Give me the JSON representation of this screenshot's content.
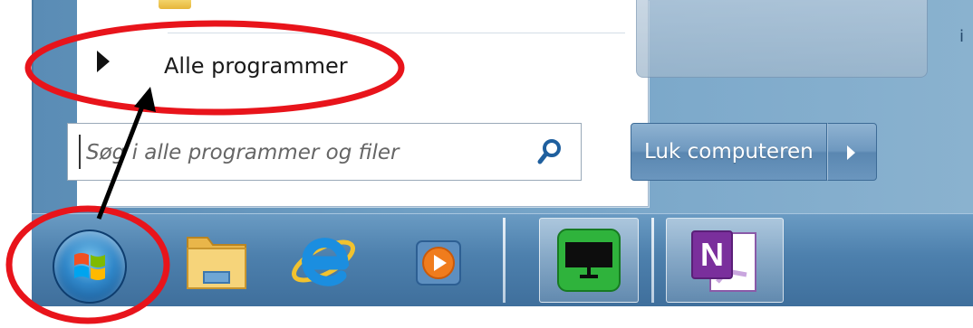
{
  "start_menu": {
    "all_programs_label": "Alle programmer",
    "search": {
      "placeholder": "Søg i alle programmer og filer",
      "value": ""
    },
    "shutdown_label": "Luk computeren",
    "right_edge_text": "i"
  },
  "taskbar": {
    "items": [
      {
        "name": "start-orb",
        "icon": "windows-logo-icon"
      },
      {
        "name": "file-explorer",
        "icon": "folder-icon"
      },
      {
        "name": "internet-explorer",
        "icon": "internet-explorer-icon"
      },
      {
        "name": "media-player",
        "icon": "media-player-icon"
      },
      {
        "name": "remote-desktop",
        "icon": "monitor-icon",
        "active": true
      },
      {
        "name": "onenote",
        "icon": "onenote-icon",
        "active": true,
        "letter": "N"
      }
    ]
  },
  "annotations": {
    "highlight_color": "#e8141b",
    "arrow_color": "#000000"
  }
}
